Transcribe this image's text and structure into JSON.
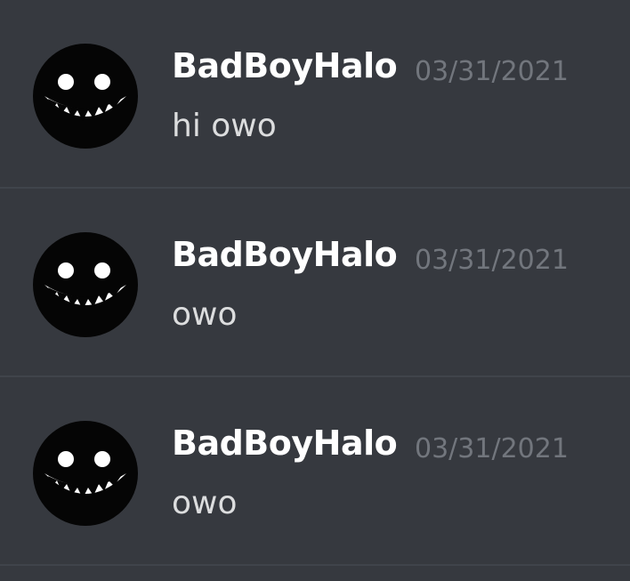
{
  "colors": {
    "background": "#36393f",
    "divider": "#40444b",
    "username": "#ffffff",
    "timestamp": "#72767d",
    "text": "#dcddde"
  },
  "messages": [
    {
      "author": "BadBoyHalo",
      "timestamp": "03/31/2021",
      "content": "hi owo",
      "avatar_icon": "grinning-face-icon"
    },
    {
      "author": "BadBoyHalo",
      "timestamp": "03/31/2021",
      "content": "owo",
      "avatar_icon": "grinning-face-icon"
    },
    {
      "author": "BadBoyHalo",
      "timestamp": "03/31/2021",
      "content": "owo",
      "avatar_icon": "grinning-face-icon"
    }
  ]
}
